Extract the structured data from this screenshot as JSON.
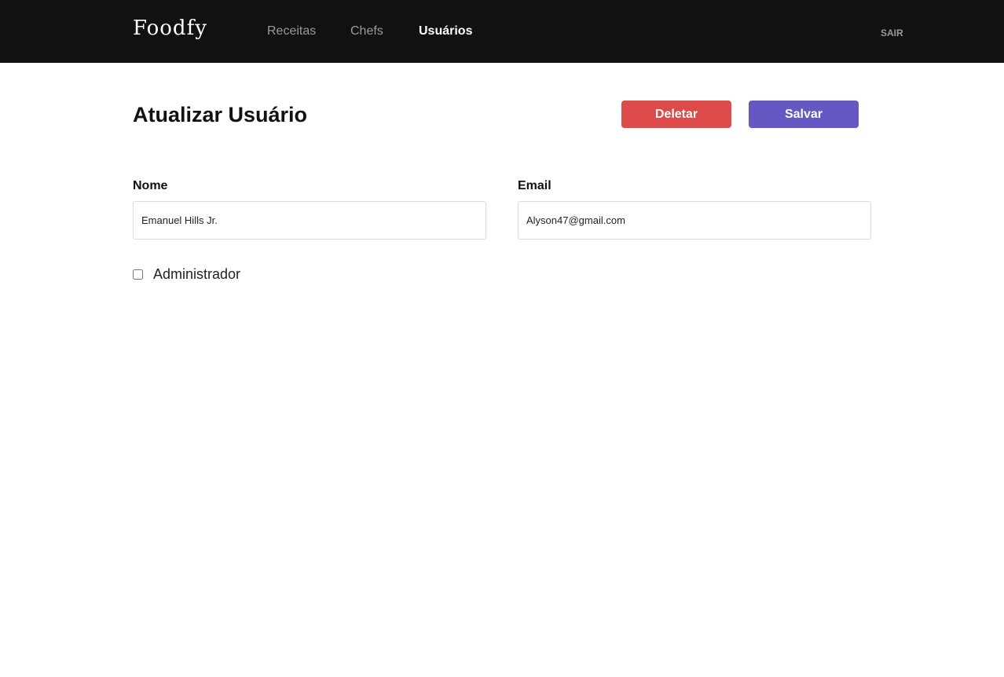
{
  "header": {
    "logo": "Foodfy",
    "nav": [
      {
        "label": "Receitas",
        "active": false
      },
      {
        "label": "Chefs",
        "active": false
      },
      {
        "label": "Usuários",
        "active": true
      }
    ],
    "logout_label": "SAIR"
  },
  "page": {
    "title": "Atualizar Usuário",
    "delete_label": "Deletar",
    "save_label": "Salvar"
  },
  "form": {
    "name_label": "Nome",
    "name_value": "Emanuel Hills Jr.",
    "email_label": "Email",
    "email_value": "Alyson47@gmail.com",
    "admin_label": "Administrador",
    "admin_checked": false
  },
  "colors": {
    "header_bg": "#111111",
    "delete_button": "#dc4a4a",
    "save_button": "#6558c3"
  }
}
